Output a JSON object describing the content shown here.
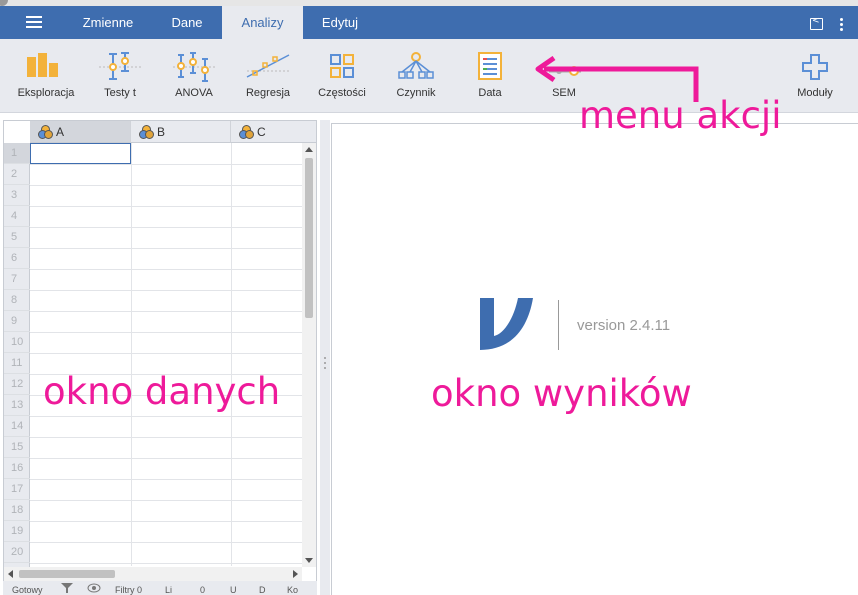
{
  "tabs": [
    {
      "label": "Zmienne"
    },
    {
      "label": "Dane"
    },
    {
      "label": "Analizy"
    },
    {
      "label": "Edytuj"
    }
  ],
  "active_tab": "Analizy",
  "ribbon": {
    "items": [
      {
        "label": "Eksploracja",
        "icon": "bar-chart-icon"
      },
      {
        "label": "Testy t",
        "icon": "t-test-icon"
      },
      {
        "label": "ANOVA",
        "icon": "anova-icon"
      },
      {
        "label": "Regresja",
        "icon": "regression-icon"
      },
      {
        "label": "Częstości",
        "icon": "frequencies-icon"
      },
      {
        "label": "Czynnik",
        "icon": "factor-icon"
      },
      {
        "label": "Data",
        "icon": "data-icon"
      },
      {
        "label": "SEM",
        "icon": "sem-icon"
      },
      {
        "label": "Moduły",
        "icon": "plus-icon"
      }
    ]
  },
  "spreadsheet": {
    "columns": [
      "A",
      "B",
      "C"
    ],
    "rows": [
      "1",
      "2",
      "3",
      "4",
      "5",
      "6",
      "7",
      "8",
      "9",
      "10",
      "11",
      "12",
      "13",
      "14",
      "15",
      "16",
      "17",
      "18",
      "19",
      "20"
    ],
    "selected_cell": "A1"
  },
  "statusbar": {
    "ready": "Gotowy",
    "filters": "Filtry 0",
    "counts": [
      "Li",
      "0",
      "U",
      "D",
      "Ko"
    ]
  },
  "results": {
    "version": "version 2.4.11"
  },
  "annotations": {
    "menu": "menu akcji",
    "data_window": "okno danych",
    "results_window": "okno wyników"
  },
  "colors": {
    "brand_blue": "#3e6daf",
    "ribbon_bg": "#e8eaef",
    "annotation_pink": "#ee1a9a",
    "icon_orange": "#f3b23a",
    "icon_blue": "#5b8fd6"
  }
}
